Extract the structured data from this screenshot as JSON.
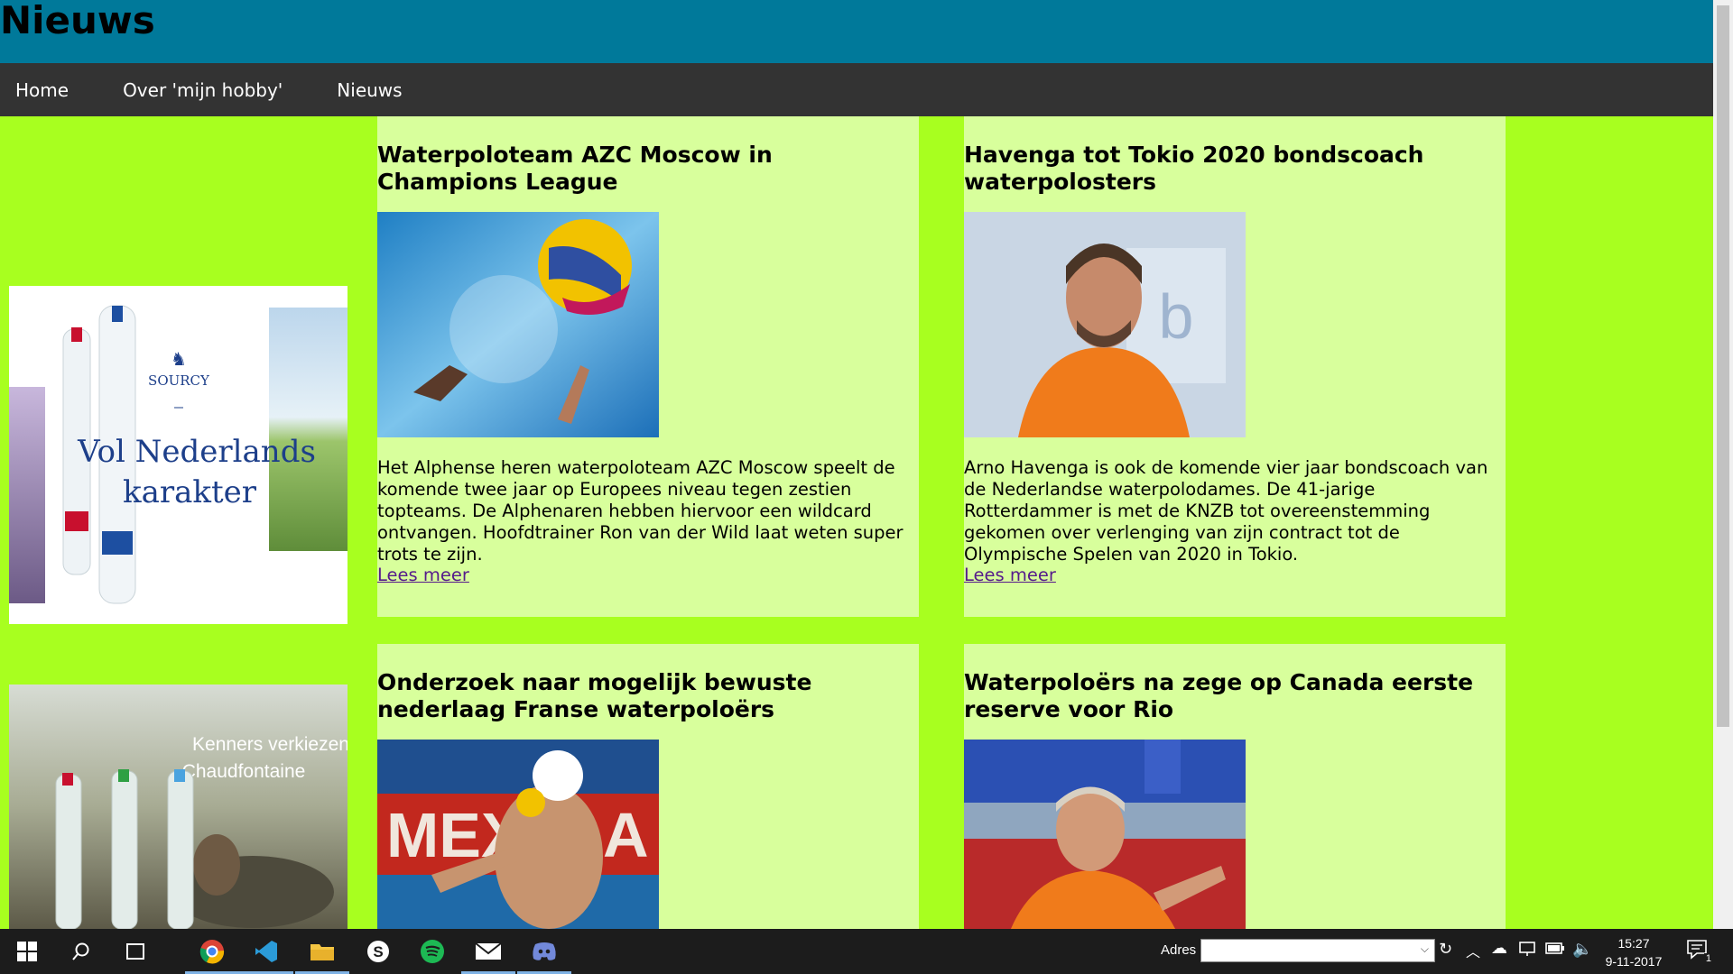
{
  "header": {
    "title": "Nieuws"
  },
  "nav": {
    "items": [
      "Home",
      "Over 'mijn hobby'",
      "Nieuws"
    ]
  },
  "sidebar": {
    "ads": [
      {
        "brand": "SOURCY",
        "slogan": "Vol Nederlands karakter"
      },
      {
        "brand": "Chaudfontaine",
        "slogan": "Kenners verkiezen Chaudfontaine"
      }
    ]
  },
  "articles": [
    {
      "title": "Waterpoloteam AZC Moscow in Champions League",
      "body": "Het Alphense heren waterpoloteam AZC Moscow speelt de komende twee jaar op Europees niveau tegen zestien topteams. De Alphenaren hebben hiervoor een wildcard ontvangen. Hoofdtrainer Ron van der Wild laat weten super trots te zijn.",
      "link": "Lees meer"
    },
    {
      "title": "Havenga tot Tokio 2020 bondscoach waterpolosters",
      "body": "Arno Havenga is ook de komende vier jaar bondscoach van de Nederlandse waterpolodames. De 41-jarige Rotterdammer is met de KNZB tot overeenstemming gekomen over verlenging van zijn contract tot de Olympische Spelen van 2020 in Tokio.",
      "link": "Lees meer"
    },
    {
      "title": "Onderzoek naar mogelijk bewuste nederlaag Franse waterpoloërs",
      "body": "",
      "link": ""
    },
    {
      "title": "Waterpoloërs na zege op Canada eerste reserve voor Rio",
      "body": "",
      "link": ""
    }
  ],
  "taskbar": {
    "address_label": "Adres",
    "address_value": "",
    "time": "15:27",
    "date": "9-11-2017",
    "notification_count": "1",
    "icons": [
      "windows-start-icon",
      "search-icon",
      "task-view-icon",
      "chrome-icon",
      "vscode-icon",
      "file-explorer-icon",
      "skype-icon",
      "spotify-icon",
      "mail-icon",
      "discord-icon"
    ]
  }
}
